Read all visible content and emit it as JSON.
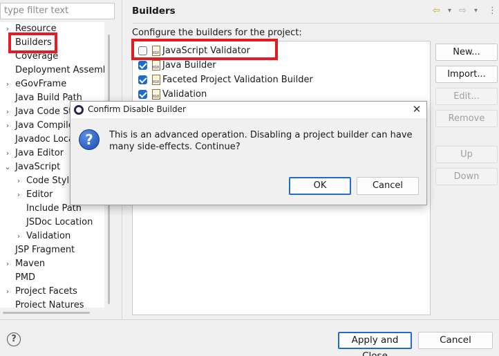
{
  "filter": {
    "placeholder": "type filter text"
  },
  "tree": [
    {
      "label": "Resource",
      "expander": "right"
    },
    {
      "label": "Builders",
      "expander": "none"
    },
    {
      "label": "Coverage",
      "expander": "none"
    },
    {
      "label": "Deployment Assembly",
      "expander": "none"
    },
    {
      "label": "eGovFrame",
      "expander": "right"
    },
    {
      "label": "Java Build Path",
      "expander": "none"
    },
    {
      "label": "Java Code Style",
      "expander": "right"
    },
    {
      "label": "Java Compiler",
      "expander": "right"
    },
    {
      "label": "Javadoc Location",
      "expander": "none"
    },
    {
      "label": "Java Editor",
      "expander": "right"
    },
    {
      "label": "JavaScript",
      "expander": "down"
    },
    {
      "label": "Code Style",
      "expander": "right",
      "child": true
    },
    {
      "label": "Editor",
      "expander": "right",
      "child": true
    },
    {
      "label": "Include Path",
      "expander": "none",
      "child": true
    },
    {
      "label": "JSDoc Location",
      "expander": "none",
      "child": true
    },
    {
      "label": "Validation",
      "expander": "right",
      "child": true
    },
    {
      "label": "JSP Fragment",
      "expander": "none"
    },
    {
      "label": "Maven",
      "expander": "right"
    },
    {
      "label": "PMD",
      "expander": "none"
    },
    {
      "label": "Project Facets",
      "expander": "right"
    },
    {
      "label": "Project Natures",
      "expander": "none"
    }
  ],
  "page": {
    "title": "Builders",
    "description": "Configure the builders for the project:",
    "nav": {
      "back": "⇦",
      "back_menu": "▾",
      "forward": "⇨",
      "forward_menu": "▾",
      "view_menu": "⋮"
    }
  },
  "builders": [
    {
      "label": "JavaScript Validator",
      "checked": false
    },
    {
      "label": "Java Builder",
      "checked": true
    },
    {
      "label": "Faceted Project Validation Builder",
      "checked": true
    },
    {
      "label": "Validation",
      "checked": true
    }
  ],
  "side_buttons": [
    {
      "label": "New...",
      "enabled": true
    },
    {
      "label": "Import...",
      "enabled": true
    },
    {
      "label": "Edit...",
      "enabled": false
    },
    {
      "label": "Remove",
      "enabled": false
    },
    {
      "label": "Up",
      "enabled": false
    },
    {
      "label": "Down",
      "enabled": false
    }
  ],
  "footer": {
    "help": "?",
    "apply_close": "Apply and Close",
    "cancel": "Cancel"
  },
  "dialog": {
    "title": "Confirm Disable Builder",
    "close": "✕",
    "icon": "?",
    "message": "This is an advanced operation. Disabling a project builder can have many side-effects. Continue?",
    "ok": "OK",
    "cancel": "Cancel"
  },
  "colors": {
    "accent": "#1f6bc9",
    "highlight": "#e21b25"
  }
}
